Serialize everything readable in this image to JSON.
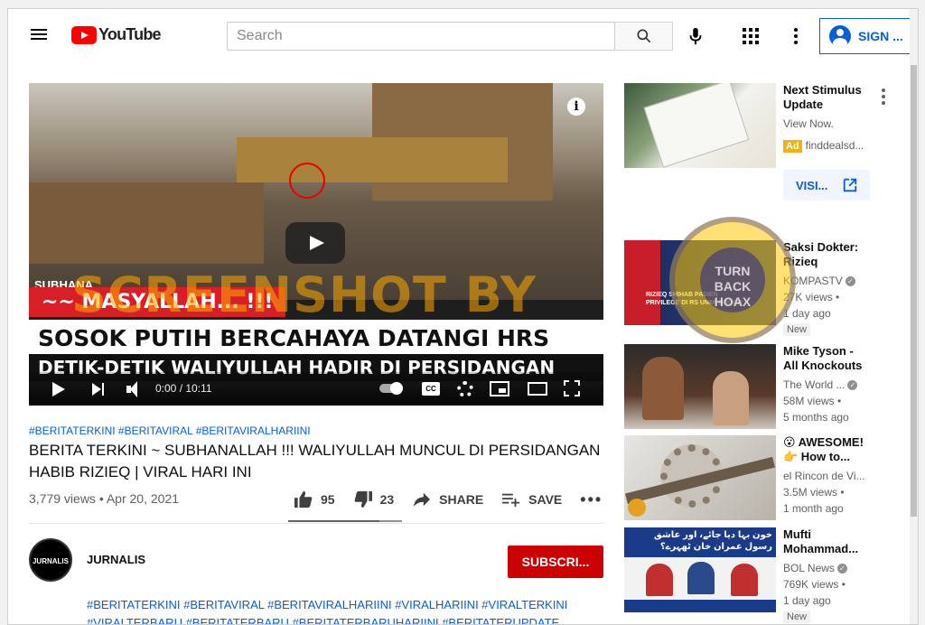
{
  "header": {
    "logo_text": "YouTube",
    "search_placeholder": "Search",
    "sign_in_label": "SIGN ..."
  },
  "player": {
    "caption_top": "~~ MASYALLAH... !!!",
    "caption_main": "SOSOK PUTIH BERCAHAYA DATANGI HRS",
    "caption_bottom": "DETIK-DETIK WALIYULLAH HADIR DI PERSIDANGAN",
    "partial_text": "SUBHANA",
    "time": "0:00 / 10:11",
    "cc_label": "CC",
    "info_label": "i",
    "watermark": "SCREENSHOT BY",
    "seal_text": "TURN BACK HOAX"
  },
  "video": {
    "hashtags": "#BERITATERKINI #BERITAVIRAL #BERITAVIRALHARIINI",
    "title": "BERITA TERKINI ~ SUBHANALLAH !!! WALIYULLAH MUNCUL DI PERSIDANGAN HABIB RIZIEQ | VIRAL HARI INI",
    "views_date": "3,779 views • Apr 20, 2021",
    "likes": "95",
    "dislikes": "23",
    "share_label": "SHARE",
    "save_label": "SAVE",
    "like_ratio": 0.805
  },
  "channel": {
    "avatar_text": "JURNALIS",
    "name": "JURNALIS",
    "subscribe_label": "SUBSCRI...",
    "description_tags": "#BERITATERKINI #BERITAVIRAL #BERITAVIRALHARIINI #VIRALHARIINI #VIRALTERKINI #VIRALTERBARU #BERITATERBARU #BERITATERBARUHARIINI #BERITATERUPDATE"
  },
  "sidebar": {
    "ad": {
      "title": "Next Stimulus Update",
      "subtitle": "View Now.",
      "ad_label": "Ad",
      "domain": "finddealsd...",
      "visit_label": "VISI..."
    },
    "items": [
      {
        "title": "Saksi Dokter: Rizieq Shihab...",
        "channel": "KOMPASTV",
        "views": "27K views •",
        "age": "1 day ago",
        "badge": "New",
        "thumb_text": "RIZIEQ SHIHAB PASIEN PRIVILEGE DI RS UMMI BOGOR"
      },
      {
        "title": "Mike Tyson - All Knockouts of...",
        "channel": "The World ...",
        "views": "58M views •",
        "age": "5 months ago",
        "badge": ""
      },
      {
        "title": "😮 AWESOME! 👉 How to...",
        "channel": "el Rincon de Vi...",
        "views": "3.5M views •",
        "age": "1 month ago",
        "badge": ""
      },
      {
        "title": "Mufti Mohammad...",
        "channel": "BOL News",
        "views": "769K views •",
        "age": "1 day ago",
        "badge": "New",
        "thumb_text": "خون بہا دیا جائے، اور عاشق رسول عمران خان ٹھہرے؟"
      }
    ]
  }
}
